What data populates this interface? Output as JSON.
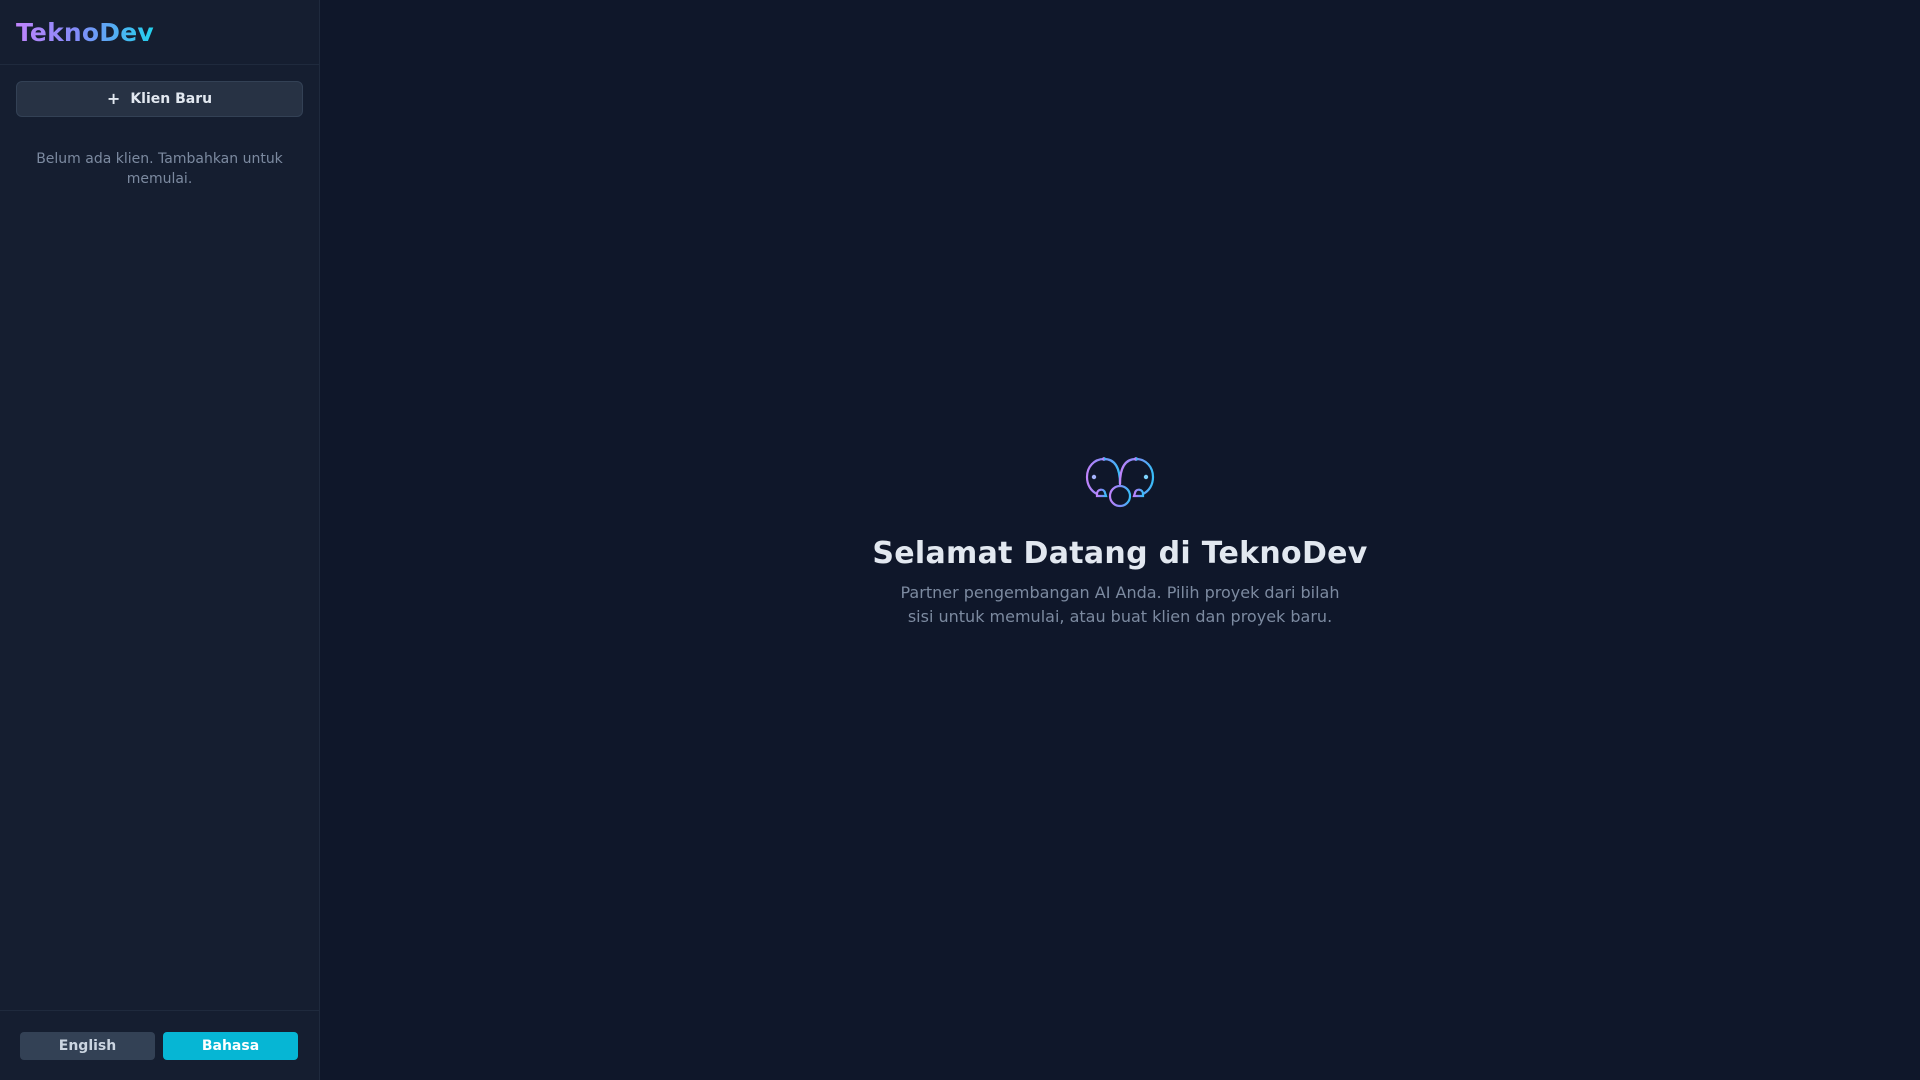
{
  "app": {
    "name": "TeknoDev"
  },
  "sidebar": {
    "new_client_label": "Klien Baru",
    "new_client_icon": "plus-icon",
    "empty_message": "Belum ada klien. Tambahkan untuk memulai."
  },
  "language": {
    "english_label": "English",
    "bahasa_label": "Bahasa",
    "active": "Bahasa"
  },
  "main": {
    "logo_icon": "brain-logo-icon",
    "title": "Selamat Datang di TeknoDev",
    "subtitle": "Partner pengembangan AI Anda. Pilih proyek dari bilah sisi untuk memulai, atau buat klien dan proyek baru."
  },
  "colors": {
    "background": "#0f172a",
    "sidebar": "#151e30",
    "accent": "#06b6d4",
    "gradient_start": "#c084fc",
    "gradient_end": "#22d3ee"
  }
}
